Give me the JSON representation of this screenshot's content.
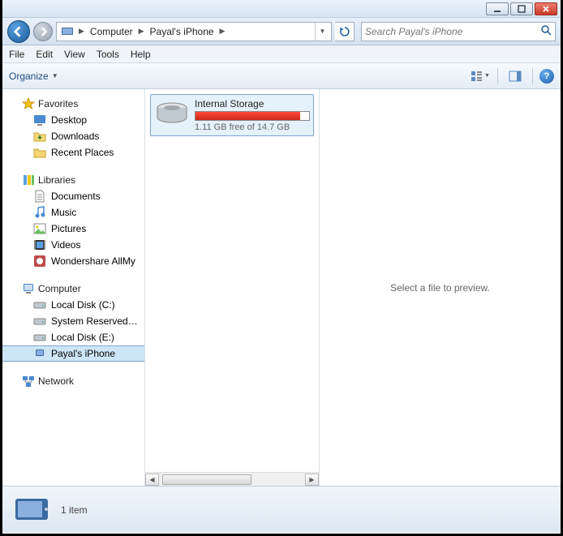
{
  "breadcrumb": {
    "segments": [
      "Computer",
      "Payal's iPhone"
    ]
  },
  "search": {
    "placeholder": "Search Payal's iPhone"
  },
  "menubar": {
    "file": "File",
    "edit": "Edit",
    "view": "View",
    "tools": "Tools",
    "help": "Help"
  },
  "toolbar": {
    "organize": "Organize"
  },
  "sidebar": {
    "favorites": {
      "label": "Favorites",
      "items": [
        "Desktop",
        "Downloads",
        "Recent Places"
      ]
    },
    "libraries": {
      "label": "Libraries",
      "items": [
        "Documents",
        "Music",
        "Pictures",
        "Videos",
        "Wondershare AllMy"
      ]
    },
    "computer": {
      "label": "Computer",
      "items": [
        "Local Disk (C:)",
        "System Reserved (D:",
        "Local Disk (E:)",
        "Payal's iPhone"
      ]
    },
    "network": {
      "label": "Network"
    }
  },
  "content": {
    "item": {
      "name": "Internal Storage",
      "free_text": "1.11 GB free of 14.7 GB",
      "fill_percent": 92
    }
  },
  "preview": {
    "message": "Select a file to preview."
  },
  "status": {
    "count_text": "1 item"
  }
}
